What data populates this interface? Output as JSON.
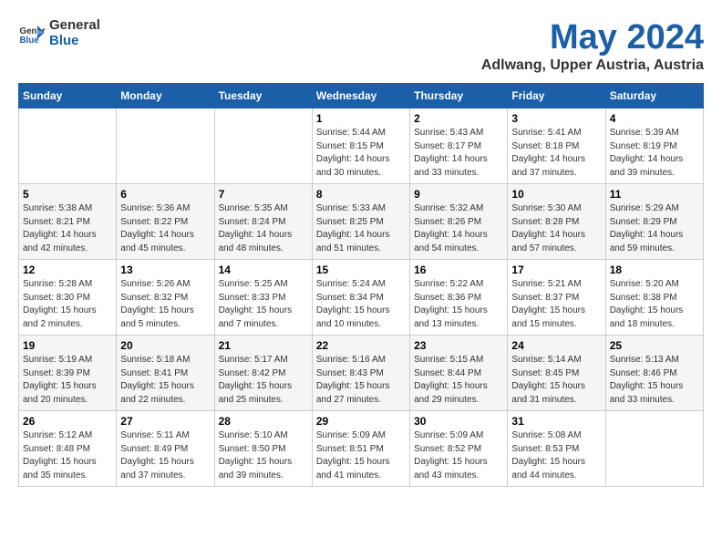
{
  "header": {
    "logo_general": "General",
    "logo_blue": "Blue",
    "title": "May 2024",
    "subtitle": "Adlwang, Upper Austria, Austria"
  },
  "weekdays": [
    "Sunday",
    "Monday",
    "Tuesday",
    "Wednesday",
    "Thursday",
    "Friday",
    "Saturday"
  ],
  "weeks": [
    [
      {
        "day": "",
        "info": ""
      },
      {
        "day": "",
        "info": ""
      },
      {
        "day": "",
        "info": ""
      },
      {
        "day": "1",
        "info": "Sunrise: 5:44 AM\nSunset: 8:15 PM\nDaylight: 14 hours\nand 30 minutes."
      },
      {
        "day": "2",
        "info": "Sunrise: 5:43 AM\nSunset: 8:17 PM\nDaylight: 14 hours\nand 33 minutes."
      },
      {
        "day": "3",
        "info": "Sunrise: 5:41 AM\nSunset: 8:18 PM\nDaylight: 14 hours\nand 37 minutes."
      },
      {
        "day": "4",
        "info": "Sunrise: 5:39 AM\nSunset: 8:19 PM\nDaylight: 14 hours\nand 39 minutes."
      }
    ],
    [
      {
        "day": "5",
        "info": "Sunrise: 5:38 AM\nSunset: 8:21 PM\nDaylight: 14 hours\nand 42 minutes."
      },
      {
        "day": "6",
        "info": "Sunrise: 5:36 AM\nSunset: 8:22 PM\nDaylight: 14 hours\nand 45 minutes."
      },
      {
        "day": "7",
        "info": "Sunrise: 5:35 AM\nSunset: 8:24 PM\nDaylight: 14 hours\nand 48 minutes."
      },
      {
        "day": "8",
        "info": "Sunrise: 5:33 AM\nSunset: 8:25 PM\nDaylight: 14 hours\nand 51 minutes."
      },
      {
        "day": "9",
        "info": "Sunrise: 5:32 AM\nSunset: 8:26 PM\nDaylight: 14 hours\nand 54 minutes."
      },
      {
        "day": "10",
        "info": "Sunrise: 5:30 AM\nSunset: 8:28 PM\nDaylight: 14 hours\nand 57 minutes."
      },
      {
        "day": "11",
        "info": "Sunrise: 5:29 AM\nSunset: 8:29 PM\nDaylight: 14 hours\nand 59 minutes."
      }
    ],
    [
      {
        "day": "12",
        "info": "Sunrise: 5:28 AM\nSunset: 8:30 PM\nDaylight: 15 hours\nand 2 minutes."
      },
      {
        "day": "13",
        "info": "Sunrise: 5:26 AM\nSunset: 8:32 PM\nDaylight: 15 hours\nand 5 minutes."
      },
      {
        "day": "14",
        "info": "Sunrise: 5:25 AM\nSunset: 8:33 PM\nDaylight: 15 hours\nand 7 minutes."
      },
      {
        "day": "15",
        "info": "Sunrise: 5:24 AM\nSunset: 8:34 PM\nDaylight: 15 hours\nand 10 minutes."
      },
      {
        "day": "16",
        "info": "Sunrise: 5:22 AM\nSunset: 8:36 PM\nDaylight: 15 hours\nand 13 minutes."
      },
      {
        "day": "17",
        "info": "Sunrise: 5:21 AM\nSunset: 8:37 PM\nDaylight: 15 hours\nand 15 minutes."
      },
      {
        "day": "18",
        "info": "Sunrise: 5:20 AM\nSunset: 8:38 PM\nDaylight: 15 hours\nand 18 minutes."
      }
    ],
    [
      {
        "day": "19",
        "info": "Sunrise: 5:19 AM\nSunset: 8:39 PM\nDaylight: 15 hours\nand 20 minutes."
      },
      {
        "day": "20",
        "info": "Sunrise: 5:18 AM\nSunset: 8:41 PM\nDaylight: 15 hours\nand 22 minutes."
      },
      {
        "day": "21",
        "info": "Sunrise: 5:17 AM\nSunset: 8:42 PM\nDaylight: 15 hours\nand 25 minutes."
      },
      {
        "day": "22",
        "info": "Sunrise: 5:16 AM\nSunset: 8:43 PM\nDaylight: 15 hours\nand 27 minutes."
      },
      {
        "day": "23",
        "info": "Sunrise: 5:15 AM\nSunset: 8:44 PM\nDaylight: 15 hours\nand 29 minutes."
      },
      {
        "day": "24",
        "info": "Sunrise: 5:14 AM\nSunset: 8:45 PM\nDaylight: 15 hours\nand 31 minutes."
      },
      {
        "day": "25",
        "info": "Sunrise: 5:13 AM\nSunset: 8:46 PM\nDaylight: 15 hours\nand 33 minutes."
      }
    ],
    [
      {
        "day": "26",
        "info": "Sunrise: 5:12 AM\nSunset: 8:48 PM\nDaylight: 15 hours\nand 35 minutes."
      },
      {
        "day": "27",
        "info": "Sunrise: 5:11 AM\nSunset: 8:49 PM\nDaylight: 15 hours\nand 37 minutes."
      },
      {
        "day": "28",
        "info": "Sunrise: 5:10 AM\nSunset: 8:50 PM\nDaylight: 15 hours\nand 39 minutes."
      },
      {
        "day": "29",
        "info": "Sunrise: 5:09 AM\nSunset: 8:51 PM\nDaylight: 15 hours\nand 41 minutes."
      },
      {
        "day": "30",
        "info": "Sunrise: 5:09 AM\nSunset: 8:52 PM\nDaylight: 15 hours\nand 43 minutes."
      },
      {
        "day": "31",
        "info": "Sunrise: 5:08 AM\nSunset: 8:53 PM\nDaylight: 15 hours\nand 44 minutes."
      },
      {
        "day": "",
        "info": ""
      }
    ]
  ]
}
